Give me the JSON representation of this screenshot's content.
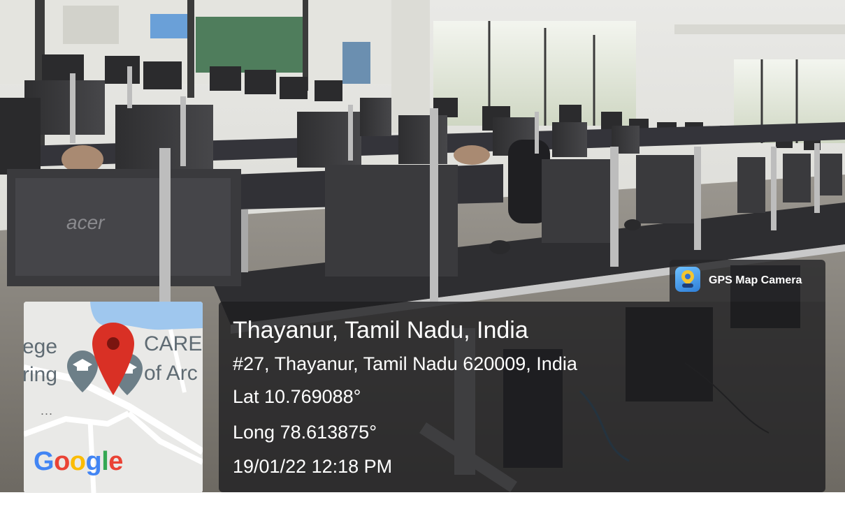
{
  "overlay": {
    "app_name": "GPS Map Camera",
    "location_title": "Thayanur, Tamil Nadu, India",
    "address": "#27, Thayanur, Tamil Nadu 620009, India",
    "latitude": "Lat 10.769088°",
    "longitude": "Long 78.613875°",
    "datetime": "19/01/22 12:18 PM"
  },
  "map": {
    "label_left_top": "ege",
    "label_left_bottom": "ring",
    "label_right_top": "CARE",
    "label_right_bottom": "of Arc",
    "dots": "...",
    "google_letters": [
      "G",
      "o",
      "o",
      "g",
      "l",
      "e"
    ],
    "google_colors": [
      "#4285F4",
      "#EA4335",
      "#FBBC05",
      "#4285F4",
      "#34A853",
      "#EA4335"
    ],
    "pin_color": "#D93025"
  },
  "photo": {
    "brand_label": "acer",
    "description_icons": [
      "monitor-icon",
      "chair-icon",
      "mouse-icon"
    ]
  }
}
